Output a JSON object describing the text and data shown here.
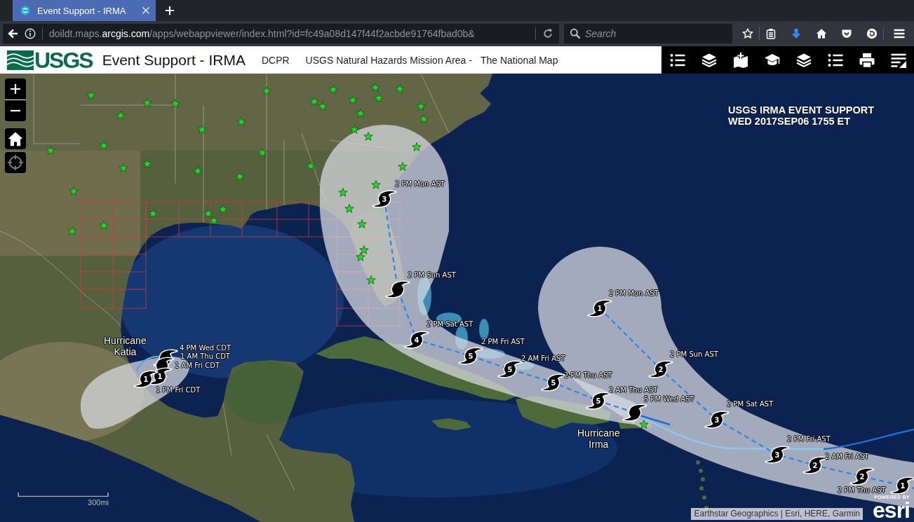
{
  "browser": {
    "tabs": [
      {
        "title": "Event Support - IRMA",
        "selected": true
      }
    ],
    "url": {
      "prefix": "doildt.maps.",
      "domain": "arcgis.com",
      "path": "/apps/webappviewer/index.html?id=fc49a08d147f44f2acbde91764fbad0b&"
    },
    "search": {
      "placeholder": "Search"
    }
  },
  "app_header": {
    "logo_text": "USGS",
    "title": "Event Support - IRMA",
    "links": [
      "DCPR",
      "USGS Natural Hazards Mission Area -",
      "The National Map"
    ]
  },
  "map": {
    "overlay_title": [
      "USGS IRMA EVENT SUPPORT",
      "WED 2017SEP06 1755 ET"
    ],
    "storms": [
      {
        "name": "Hurricane Katia",
        "points": [
          {
            "time": "4 PM Wed CDT"
          },
          {
            "time": "1 AM Thu CDT"
          },
          {
            "time": "1 AM Fri CDT",
            "category": "1"
          },
          {
            "time": "1 PM Fri CDT",
            "category": "1"
          }
        ]
      },
      {
        "name": "Hurricane Irma",
        "points": [
          {
            "time": "2 PM Mon AST",
            "category": "3"
          },
          {
            "time": "2 PM Sun AST"
          },
          {
            "time": "2 PM Sat AST",
            "category": "4"
          },
          {
            "time": "2 PM Fri AST",
            "category": "5"
          },
          {
            "time": "2 AM Fri AST",
            "category": "5"
          },
          {
            "time": "2 PM Thu AST",
            "category": "5"
          },
          {
            "time": "2 AM Thu AST",
            "category": "5"
          },
          {
            "time": "5 PM Wed AST"
          }
        ]
      },
      {
        "points": [
          {
            "time": "2 PM Mon AST",
            "category": "1"
          },
          {
            "time": "2 PM Sun AST",
            "category": "2"
          },
          {
            "time": "2 PM Sat AST",
            "category": "3"
          },
          {
            "time": "2 PM Fri AST",
            "category": "3"
          },
          {
            "time": "2 AM Fri AST",
            "category": "2"
          },
          {
            "time": "2 PM Thu AST",
            "category": "2"
          },
          {
            "category": "1"
          }
        ]
      }
    ],
    "scale_label": "300mi",
    "attribution": "Earthstar Geographics | Esri, HERE, Garmin",
    "esri_logo": {
      "tagline": "POWERED BY",
      "wordmark": "esri"
    }
  }
}
